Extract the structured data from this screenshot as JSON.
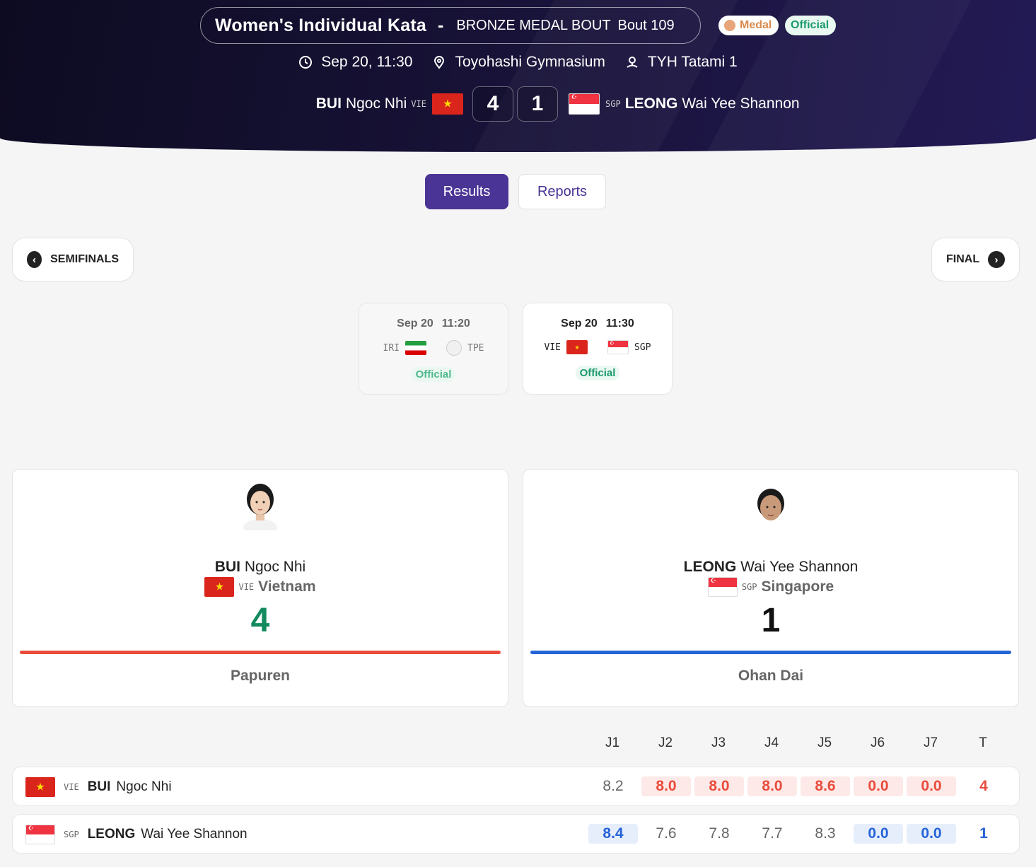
{
  "event": {
    "name": "Women's Individual Kata",
    "separator": "-",
    "phase": "BRONZE MEDAL BOUT",
    "bout": "Bout 109",
    "badges": {
      "medal": "Medal",
      "official": "Official"
    },
    "datetime": "Sep 20, 11:30",
    "venue": "Toyohashi Gymnasium",
    "area": "TYH Tatami 1"
  },
  "matchup": {
    "red": {
      "surname": "BUI",
      "given": "Ngoc Nhi",
      "noc": "VIE",
      "country": "Vietnam",
      "score": "4",
      "kata": "Papuren"
    },
    "blue": {
      "surname": "LEONG",
      "given": "Wai Yee Shannon",
      "noc": "SGP",
      "country": "Singapore",
      "score": "1",
      "kata": "Ohan Dai"
    }
  },
  "tabs": {
    "results": "Results",
    "reports": "Reports"
  },
  "nav": {
    "prev": "SEMIFINALS",
    "next": "FINAL"
  },
  "matches": [
    {
      "date": "Sep 20",
      "time": "11:20",
      "home": "IRI",
      "away": "TPE",
      "status": "Official"
    },
    {
      "date": "Sep 20",
      "time": "11:30",
      "home": "VIE",
      "away": "SGP",
      "status": "Official"
    }
  ],
  "table": {
    "headers": [
      "J1",
      "J2",
      "J3",
      "J4",
      "J5",
      "J6",
      "J7",
      "T"
    ],
    "rows": [
      {
        "noc": "VIE",
        "surname": "BUI",
        "given": "Ngoc Nhi",
        "scores": [
          "8.2",
          "8.0",
          "8.0",
          "8.0",
          "8.6",
          "0.0",
          "0.0"
        ],
        "total": "4"
      },
      {
        "noc": "SGP",
        "surname": "LEONG",
        "given": "Wai Yee Shannon",
        "scores": [
          "8.4",
          "7.6",
          "7.8",
          "7.7",
          "8.3",
          "0.0",
          "0.0"
        ],
        "total": "1"
      }
    ]
  },
  "colors": {
    "red": "#e94b3c",
    "blue": "#2563d8",
    "winner_score": "#128a5e",
    "brand": "#4a3495"
  }
}
